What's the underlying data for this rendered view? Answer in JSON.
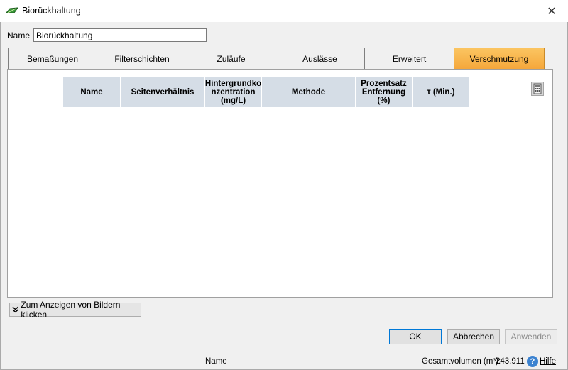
{
  "window": {
    "title": "Biorückhaltung",
    "close_glyph": "✕"
  },
  "name_field": {
    "label": "Name",
    "value": "Biorückhaltung"
  },
  "tabs": [
    {
      "label": "Bemaßungen",
      "active": false
    },
    {
      "label": "Filterschichten",
      "active": false
    },
    {
      "label": "Zuläufe",
      "active": false
    },
    {
      "label": "Auslässe",
      "active": false
    },
    {
      "label": "Erweitert",
      "active": false
    },
    {
      "label": "Verschmutzung",
      "active": true
    }
  ],
  "grid": {
    "columns": [
      "Name",
      "Seitenverhältnis",
      "Hintergrundko nzentration (mg/L)",
      "Methode",
      "Prozentsatz Entfernung (%)",
      "τ (Min.)"
    ],
    "rows": []
  },
  "show_images_button": {
    "label": "Zum Anzeigen von Bildern klicken",
    "icon": "double-chevron-down-icon"
  },
  "buttons": {
    "ok": "OK",
    "cancel": "Abbrechen",
    "apply": "Anwenden"
  },
  "status": {
    "name": "Name",
    "volume_label": "Gesamtvolumen (m³):",
    "volume_value": "243.911",
    "help": "Hilfe"
  },
  "colors": {
    "active_tab": "#f5a73b",
    "grid_header": "#d5dde6",
    "help_icon": "#3b82d0"
  }
}
